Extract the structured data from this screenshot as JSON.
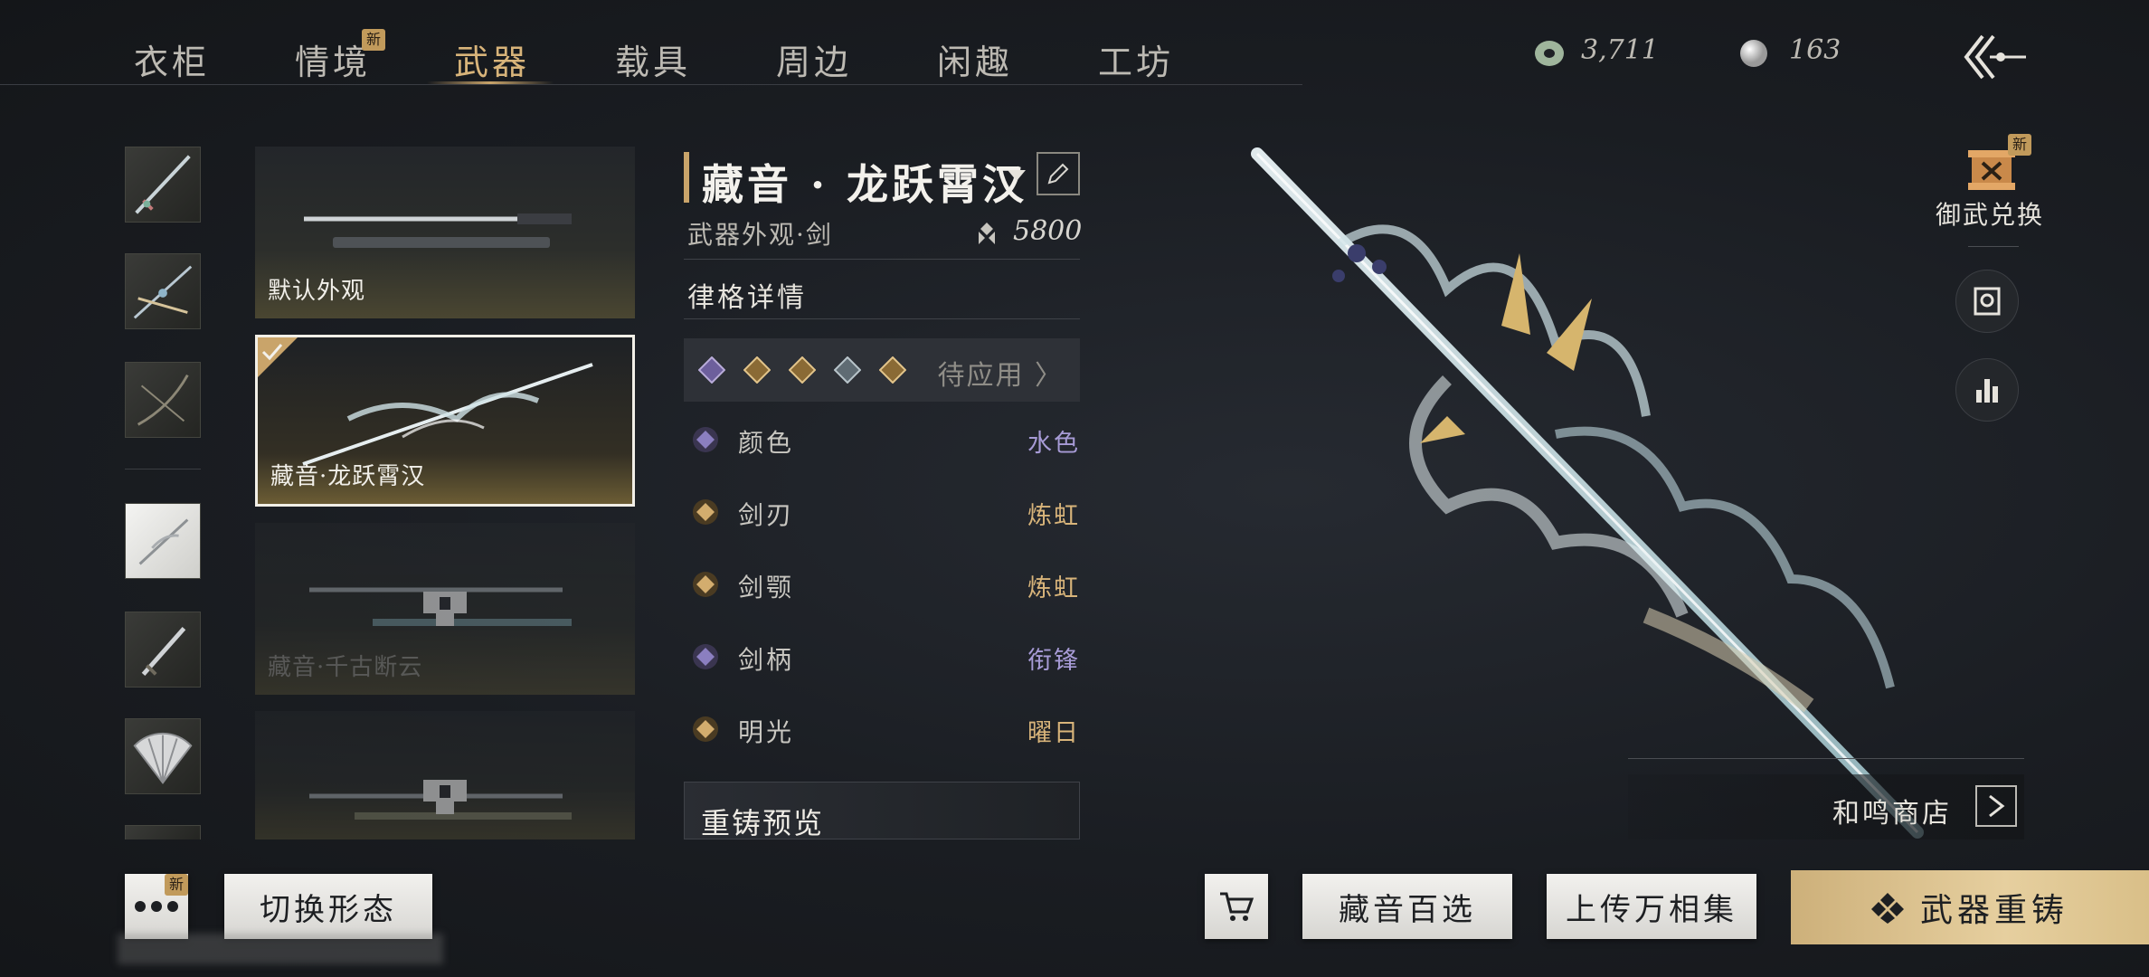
{
  "nav": {
    "tabs": [
      {
        "label": "衣柜"
      },
      {
        "label": "情境",
        "badge": "新"
      },
      {
        "label": "武器"
      },
      {
        "label": "载具"
      },
      {
        "label": "周边"
      },
      {
        "label": "闲趣"
      },
      {
        "label": "工坊"
      }
    ],
    "active_tab": "武器"
  },
  "currency": {
    "jade": "3,711",
    "pearl": "163"
  },
  "thumbnails": [
    "sword-thumb",
    "staff-thumb",
    "bow-thumb",
    "white-blade-thumb",
    "dagger-thumb",
    "fan-thumb"
  ],
  "skins": [
    {
      "label": "默认外观",
      "state": "owned"
    },
    {
      "label": "藏音·龙跃霄汉",
      "state": "selected"
    },
    {
      "label": "藏音·千古断云",
      "state": "locked"
    },
    {
      "label": "",
      "state": "locked"
    }
  ],
  "detail": {
    "title": "藏音 · 龙跃霄汉",
    "subtitle": "武器外观·剑",
    "price": "5800",
    "section_title": "律格详情",
    "apply_label": "待应用 〉",
    "attributes": [
      {
        "name": "颜色",
        "value": "水色",
        "color": "#a79bd6"
      },
      {
        "name": "剑刃",
        "value": "炼虹",
        "color": "#d8b47a"
      },
      {
        "name": "剑颚",
        "value": "炼虹",
        "color": "#d8b47a"
      },
      {
        "name": "剑柄",
        "value": "衔锋",
        "color": "#a79bd6"
      },
      {
        "name": "明光",
        "value": "曜日",
        "color": "#d8b47a"
      }
    ],
    "recast_title": "重铸预览"
  },
  "side": {
    "exchange_label": "御武兑换",
    "exchange_badge": "新",
    "shop_label": "和鸣商店"
  },
  "bottom": {
    "more_badge": "新",
    "switch_form": "切换形态",
    "collection": "藏音百选",
    "upload": "上传万相集",
    "recast": "武器重铸"
  },
  "colors": {
    "accent_gold": "#d8b47a",
    "accent_purple": "#a79bd6"
  }
}
